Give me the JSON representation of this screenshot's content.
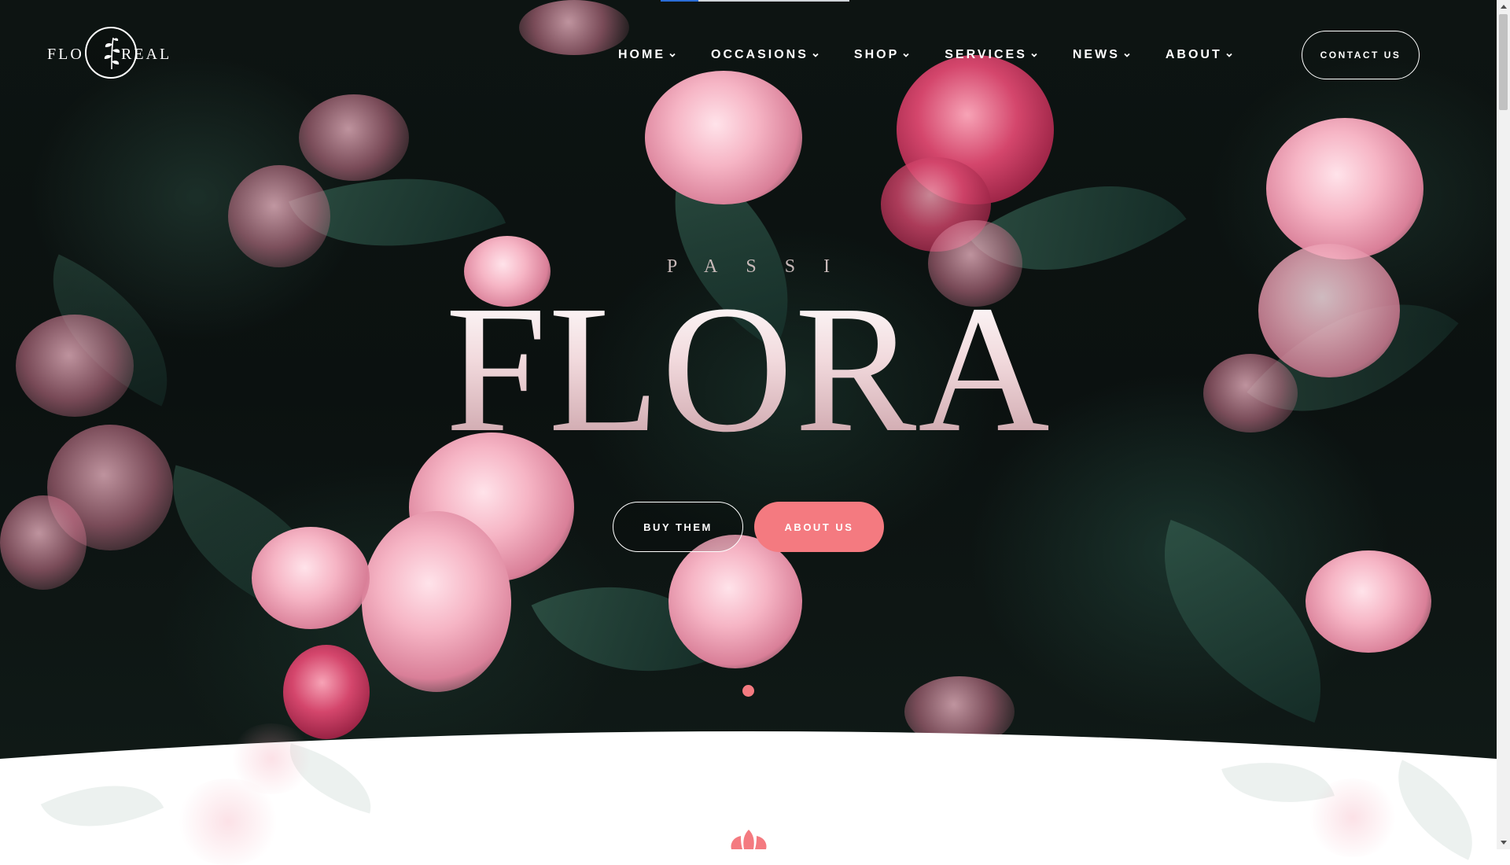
{
  "brand": {
    "logo_left": "FLO",
    "logo_right": "REAL"
  },
  "nav": {
    "items": [
      {
        "label": "HOME"
      },
      {
        "label": "OCCASIONS"
      },
      {
        "label": "SHOP"
      },
      {
        "label": "SERVICES"
      },
      {
        "label": "NEWS"
      },
      {
        "label": "ABOUT"
      }
    ],
    "contact_label": "CONTACT US"
  },
  "hero": {
    "eyebrow": "PASSI",
    "title": "FLORA",
    "buy_label": "BUY THEM",
    "about_label": "ABOUT US"
  },
  "colors": {
    "accent": "#f47a80",
    "hero_bg": "#0d1412",
    "text_light": "#ffffff"
  },
  "icons": {
    "logo": "leaf-sprig-icon",
    "nav_chevron": "chevron-down-icon",
    "section_mark": "lotus-icon"
  }
}
